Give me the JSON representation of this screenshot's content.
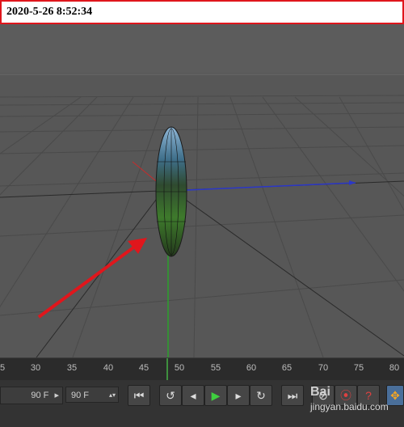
{
  "timestamp": "2020-5-26 8:52:34",
  "timeline": {
    "ticks": [
      "5",
      "30",
      "35",
      "40",
      "45",
      "50",
      "55",
      "60",
      "65",
      "70",
      "75",
      "80",
      "85"
    ]
  },
  "controls": {
    "end_frame_value": "90 F",
    "preview_end_value": "90 F"
  },
  "watermark": {
    "brand": "Bai",
    "site": "jingyan.baidu.com"
  },
  "colors": {
    "viewport_bg": "#575757",
    "annotation_arrow": "#e0161c",
    "axis_x": "#2b37c8",
    "axis_y": "#2ca02c"
  }
}
